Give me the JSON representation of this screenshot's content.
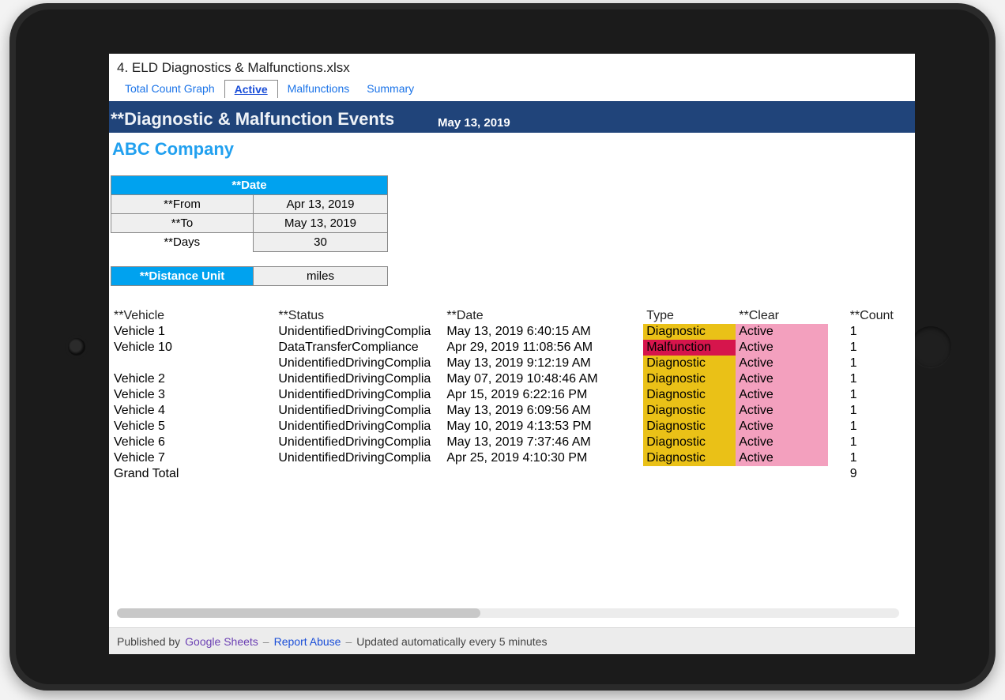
{
  "file_title": "4. ELD Diagnostics & Malfunctions.xlsx",
  "tabs": [
    {
      "label": "Total Count Graph",
      "active": false
    },
    {
      "label": "Active",
      "active": true
    },
    {
      "label": "Malfunctions",
      "active": false
    },
    {
      "label": "Summary",
      "active": false
    }
  ],
  "banner": {
    "title": "**Diagnostic & Malfunction Events",
    "date": "May 13, 2019"
  },
  "company": "ABC Company",
  "date_block": {
    "header": "**Date",
    "from_lbl": "**From",
    "to_lbl": "**To",
    "days_lbl": "**Days",
    "from": "Apr 13, 2019",
    "to": "May 13, 2019",
    "days": "30"
  },
  "distance": {
    "label": "**Distance Unit",
    "value": "miles"
  },
  "columns": {
    "vehicle": "**Vehicle",
    "status": "**Status",
    "date": "**Date",
    "type": "Type",
    "clear": "**Clear",
    "count": "**Count"
  },
  "rows": [
    {
      "vehicle": "Vehicle 1",
      "status": "UnidentifiedDrivingComplia",
      "date": "May 13, 2019 6:40:15 AM",
      "type": "Diagnostic",
      "clear": "Active",
      "count": "1"
    },
    {
      "vehicle": "Vehicle 10",
      "status": "DataTransferCompliance",
      "date": "Apr 29, 2019 11:08:56 AM",
      "type": "Malfunction",
      "clear": "Active",
      "count": "1"
    },
    {
      "vehicle": "",
      "status": "UnidentifiedDrivingComplia",
      "date": "May 13, 2019 9:12:19 AM",
      "type": "Diagnostic",
      "clear": "Active",
      "count": "1"
    },
    {
      "vehicle": "Vehicle 2",
      "status": "UnidentifiedDrivingComplia",
      "date": "May 07, 2019 10:48:46 AM",
      "type": "Diagnostic",
      "clear": "Active",
      "count": "1"
    },
    {
      "vehicle": "Vehicle 3",
      "status": "UnidentifiedDrivingComplia",
      "date": "Apr 15, 2019 6:22:16 PM",
      "type": "Diagnostic",
      "clear": "Active",
      "count": "1"
    },
    {
      "vehicle": "Vehicle 4",
      "status": "UnidentifiedDrivingComplia",
      "date": "May 13, 2019 6:09:56 AM",
      "type": "Diagnostic",
      "clear": "Active",
      "count": "1"
    },
    {
      "vehicle": "Vehicle 5",
      "status": "UnidentifiedDrivingComplia",
      "date": "May 10, 2019 4:13:53 PM",
      "type": "Diagnostic",
      "clear": "Active",
      "count": "1"
    },
    {
      "vehicle": "Vehicle 6",
      "status": "UnidentifiedDrivingComplia",
      "date": "May 13, 2019 7:37:46 AM",
      "type": "Diagnostic",
      "clear": "Active",
      "count": "1"
    },
    {
      "vehicle": "Vehicle 7",
      "status": "UnidentifiedDrivingComplia",
      "date": "Apr 25, 2019 4:10:30 PM",
      "type": "Diagnostic",
      "clear": "Active",
      "count": "1"
    }
  ],
  "grand_total": {
    "label": "Grand Total",
    "count": "9"
  },
  "footer": {
    "published_by": "Published by",
    "sheets": "Google Sheets",
    "report": "Report Abuse",
    "updated": "Updated automatically every 5 minutes"
  }
}
